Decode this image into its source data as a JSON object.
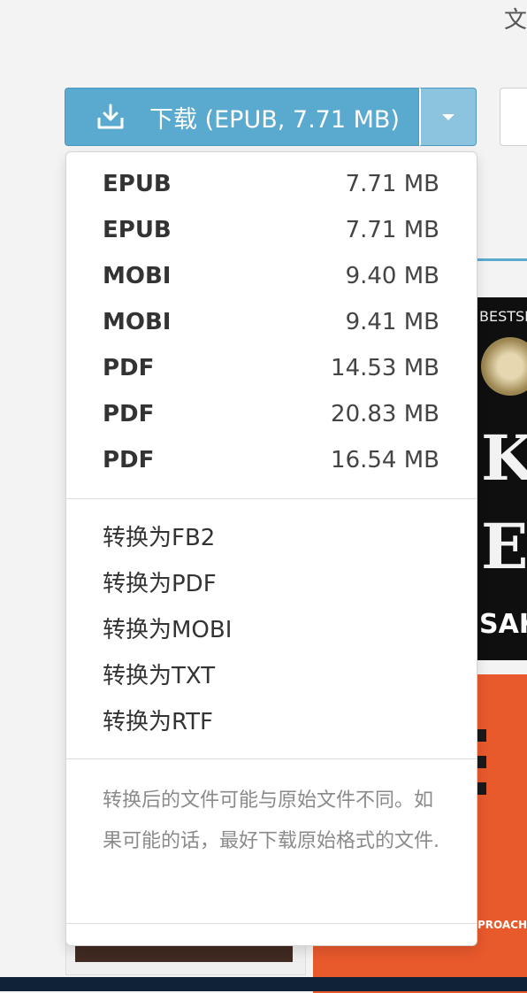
{
  "page": {
    "corner_text": "文"
  },
  "download_button": {
    "label": "下载 (EPUB, 7.71 MB)",
    "icon": "download-icon",
    "caret_icon": "caret-down-icon",
    "color": "#5aa9cf"
  },
  "dropdown": {
    "formats": [
      {
        "name": "EPUB",
        "size": "7.71 MB"
      },
      {
        "name": "EPUB",
        "size": "7.71 MB"
      },
      {
        "name": "MOBI",
        "size": "9.40 MB"
      },
      {
        "name": "MOBI",
        "size": "9.41 MB"
      },
      {
        "name": "PDF",
        "size": "14.53 MB"
      },
      {
        "name": "PDF",
        "size": "20.83 MB"
      },
      {
        "name": "PDF",
        "size": "16.54 MB"
      }
    ],
    "conversions": [
      "转换为FB2",
      "转换为PDF",
      "转换为MOBI",
      "转换为TXT",
      "转换为RTF"
    ],
    "note": "转换后的文件可能与原始文件不同。如果可能的话，最好下载原始格式的文件."
  },
  "background_covers": {
    "cover1_texts": [
      "BESTSELLE",
      "K",
      "EF",
      "SAK"
    ],
    "cover2_text": "PROACH"
  }
}
